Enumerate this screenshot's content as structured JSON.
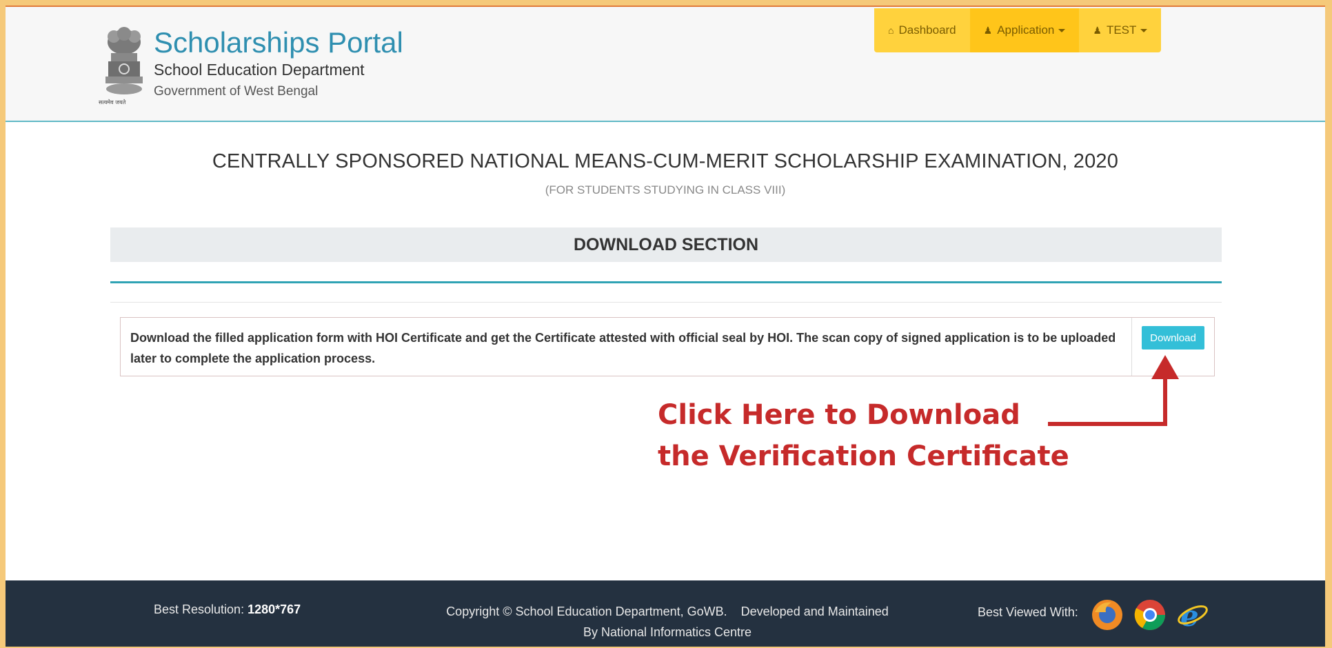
{
  "header": {
    "title": "Scholarships Portal",
    "department": "School Education Department",
    "government": "Government of West Bengal",
    "emblem_caption": "सत्यमेव जयते"
  },
  "nav": {
    "items": [
      {
        "label": "Dashboard",
        "icon": "home-icon"
      },
      {
        "label": "Application",
        "icon": "user-icon",
        "has_dropdown": true
      },
      {
        "label": "TEST",
        "icon": "user-icon",
        "has_dropdown": true
      }
    ]
  },
  "main": {
    "exam_title": "CENTRALLY SPONSORED NATIONAL MEANS-CUM-MERIT SCHOLARSHIP EXAMINATION, 2020",
    "exam_subtitle": "(FOR STUDENTS STUDYING IN CLASS VIII)",
    "section_heading": "DOWNLOAD SECTION",
    "download_text": "Download the filled application form with HOI Certificate and get the Certificate attested with official seal by HOI. The scan copy of signed application is to be uploaded later to complete the application process.",
    "download_button": "Download"
  },
  "callout": {
    "line1": "Click Here to Download",
    "line2": "the Verification Certificate"
  },
  "footer": {
    "resolution_label": "Best Resolution:",
    "resolution_value": "1280*767",
    "copyright_line1": "Copyright © School Education Department, GoWB.    Developed and Maintained",
    "copyright_line2": "By National Informatics Centre",
    "best_viewed_label": "Best Viewed With:",
    "browsers": [
      "firefox-icon",
      "chrome-icon",
      "internet-explorer-icon"
    ]
  },
  "colors": {
    "brand_blue": "#2f8fb0",
    "nav_yellow": "#ffd23d",
    "teal": "#2fa3b4",
    "button_cyan": "#33bfd8",
    "callout_red": "#c62a2a",
    "footer_dark": "#243140"
  }
}
